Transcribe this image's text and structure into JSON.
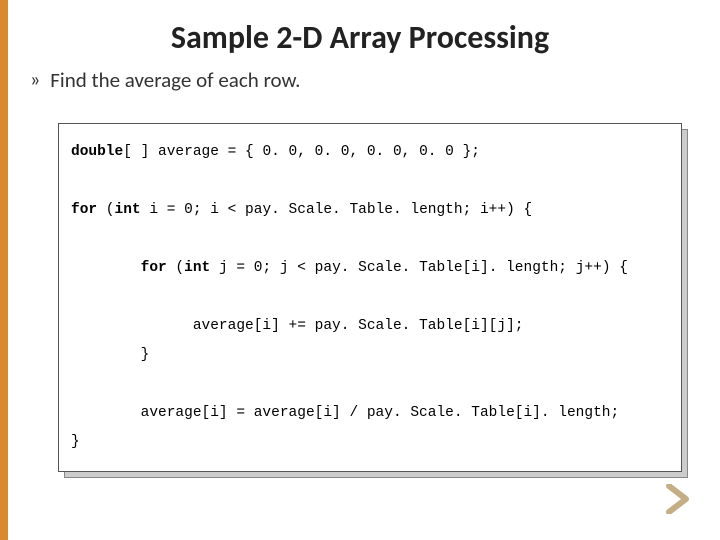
{
  "title": "Sample 2-D Array Processing",
  "bullet": {
    "glyph": "»",
    "text": "Find the average of each row."
  },
  "code": {
    "l1a": "double",
    "l1b": "[ ] average = { 0. 0, 0. 0, 0. 0, 0. 0 };",
    "l2a": "for",
    "l2b": " (",
    "l2c": "int",
    "l2d": " i = 0; i < pay. Scale. Table. length; i++) {",
    "l3pad": "        ",
    "l3a": "for",
    "l3b": " (",
    "l3c": "int",
    "l3d": " j = 0; j < pay. Scale. Table[i]. length; j++) {",
    "l4": "              average[i] += pay. Scale. Table[i][j];",
    "l5": "        }",
    "l6": "        average[i] = average[i] / pay. Scale. Table[i]. length;",
    "l7": "}"
  },
  "nav": {
    "next": "next"
  }
}
